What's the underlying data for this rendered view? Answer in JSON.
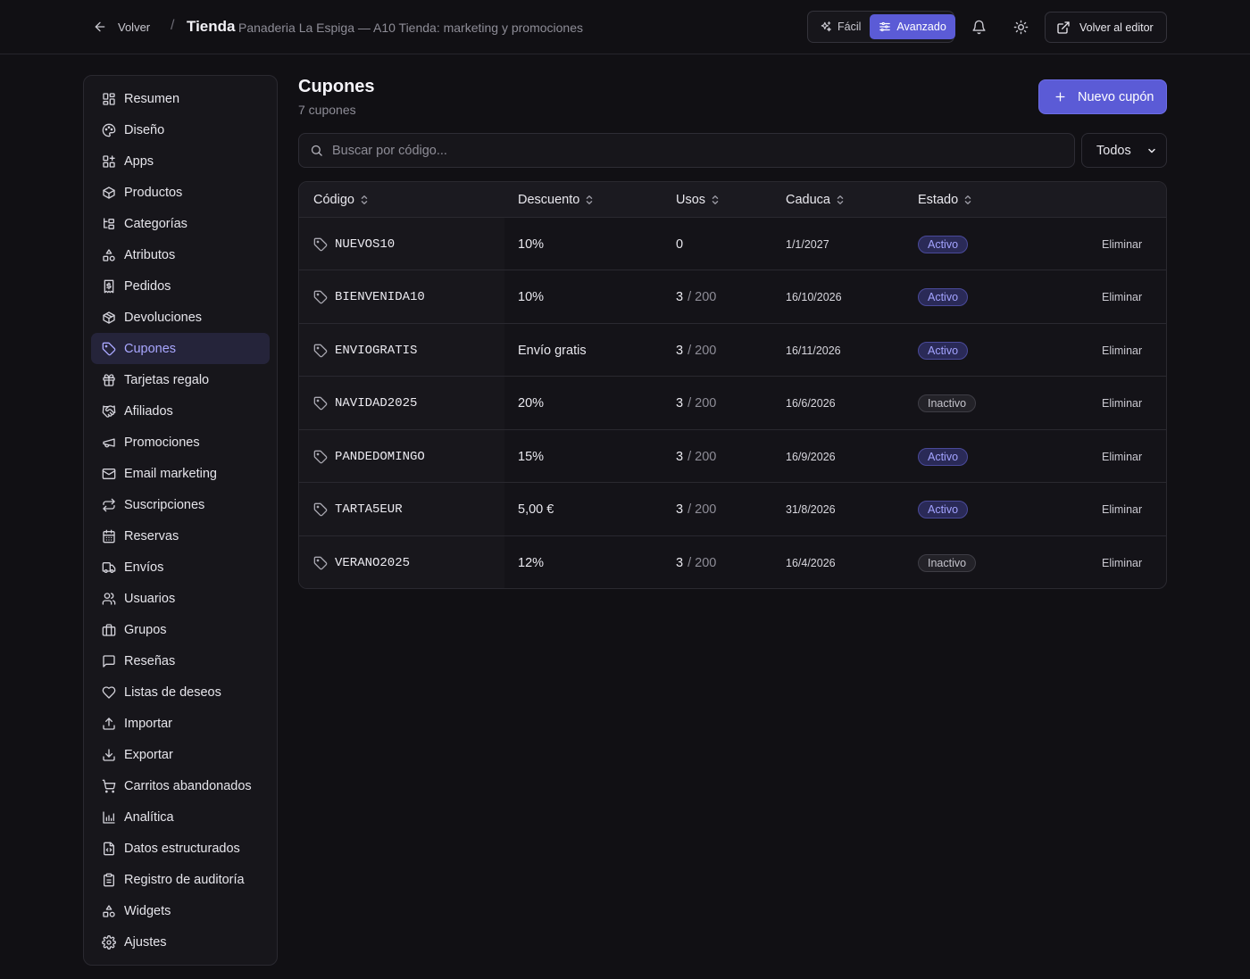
{
  "topbar": {
    "back_label": "Volver",
    "separator": "/",
    "title": "Tienda",
    "subtitle": "Panaderia La Espiga — A10 Tienda: marketing y promociones",
    "mode_easy": "Fácil",
    "mode_advanced": "Avanzado",
    "editor_label": "Volver al editor"
  },
  "sidebar": {
    "items": [
      {
        "label": "Resumen",
        "icon": "dashboard-icon"
      },
      {
        "label": "Diseño",
        "icon": "palette-icon"
      },
      {
        "label": "Apps",
        "icon": "apps-icon"
      },
      {
        "label": "Productos",
        "icon": "package-icon"
      },
      {
        "label": "Categorías",
        "icon": "categories-icon"
      },
      {
        "label": "Atributos",
        "icon": "shapes-icon"
      },
      {
        "label": "Pedidos",
        "icon": "receipt-icon"
      },
      {
        "label": "Devoluciones",
        "icon": "package-return-icon"
      },
      {
        "label": "Cupones",
        "icon": "tag-icon",
        "active": true
      },
      {
        "label": "Tarjetas regalo",
        "icon": "gift-icon"
      },
      {
        "label": "Afiliados",
        "icon": "handshake-icon"
      },
      {
        "label": "Promociones",
        "icon": "megaphone-icon"
      },
      {
        "label": "Email marketing",
        "icon": "mail-icon"
      },
      {
        "label": "Suscripciones",
        "icon": "repeat-icon"
      },
      {
        "label": "Reservas",
        "icon": "calendar-icon"
      },
      {
        "label": "Envíos",
        "icon": "truck-icon"
      },
      {
        "label": "Usuarios",
        "icon": "users-icon"
      },
      {
        "label": "Grupos",
        "icon": "briefcase-icon"
      },
      {
        "label": "Reseñas",
        "icon": "message-icon"
      },
      {
        "label": "Listas de deseos",
        "icon": "heart-icon"
      },
      {
        "label": "Importar",
        "icon": "upload-icon"
      },
      {
        "label": "Exportar",
        "icon": "download-icon"
      },
      {
        "label": "Carritos abandonados",
        "icon": "cart-icon"
      },
      {
        "label": "Analítica",
        "icon": "bar-chart-icon"
      },
      {
        "label": "Datos estructurados",
        "icon": "file-code-icon"
      },
      {
        "label": "Registro de auditoría",
        "icon": "clipboard-icon"
      },
      {
        "label": "Widgets",
        "icon": "shapes-icon"
      },
      {
        "label": "Ajustes",
        "icon": "gear-icon"
      }
    ]
  },
  "main": {
    "title": "Cupones",
    "count": "7 cupones",
    "new_button": "Nuevo cupón",
    "search_placeholder": "Buscar por código...",
    "filter_value": "Todos",
    "columns": [
      "Código",
      "Descuento",
      "Usos",
      "Caduca",
      "Estado"
    ],
    "delete_label": "Eliminar",
    "rows": [
      {
        "code": "NUEVOS10",
        "discount": "10%",
        "uses": "0",
        "max": "",
        "expires": "1/1/2027",
        "status": "Activo",
        "active": true
      },
      {
        "code": "BIENVENIDA10",
        "discount": "10%",
        "uses": "3",
        "max": "/ 200",
        "expires": "16/10/2026",
        "status": "Activo",
        "active": true
      },
      {
        "code": "ENVIOGRATIS",
        "discount": "Envío gratis",
        "uses": "3",
        "max": "/ 200",
        "expires": "16/11/2026",
        "status": "Activo",
        "active": true
      },
      {
        "code": "NAVIDAD2025",
        "discount": "20%",
        "uses": "3",
        "max": "/ 200",
        "expires": "16/6/2026",
        "status": "Inactivo",
        "active": false
      },
      {
        "code": "PANDEDOMINGO",
        "discount": "15%",
        "uses": "3",
        "max": "/ 200",
        "expires": "16/9/2026",
        "status": "Activo",
        "active": true
      },
      {
        "code": "TARTA5EUR",
        "discount": "5,00 €",
        "uses": "3",
        "max": "/ 200",
        "expires": "31/8/2026",
        "status": "Activo",
        "active": true
      },
      {
        "code": "VERANO2025",
        "discount": "12%",
        "uses": "3",
        "max": "/ 200",
        "expires": "16/4/2026",
        "status": "Inactivo",
        "active": false
      }
    ]
  },
  "colors": {
    "background": "#111014",
    "accent": "#5b5bd6",
    "active_badge": "#a3a3ff"
  }
}
